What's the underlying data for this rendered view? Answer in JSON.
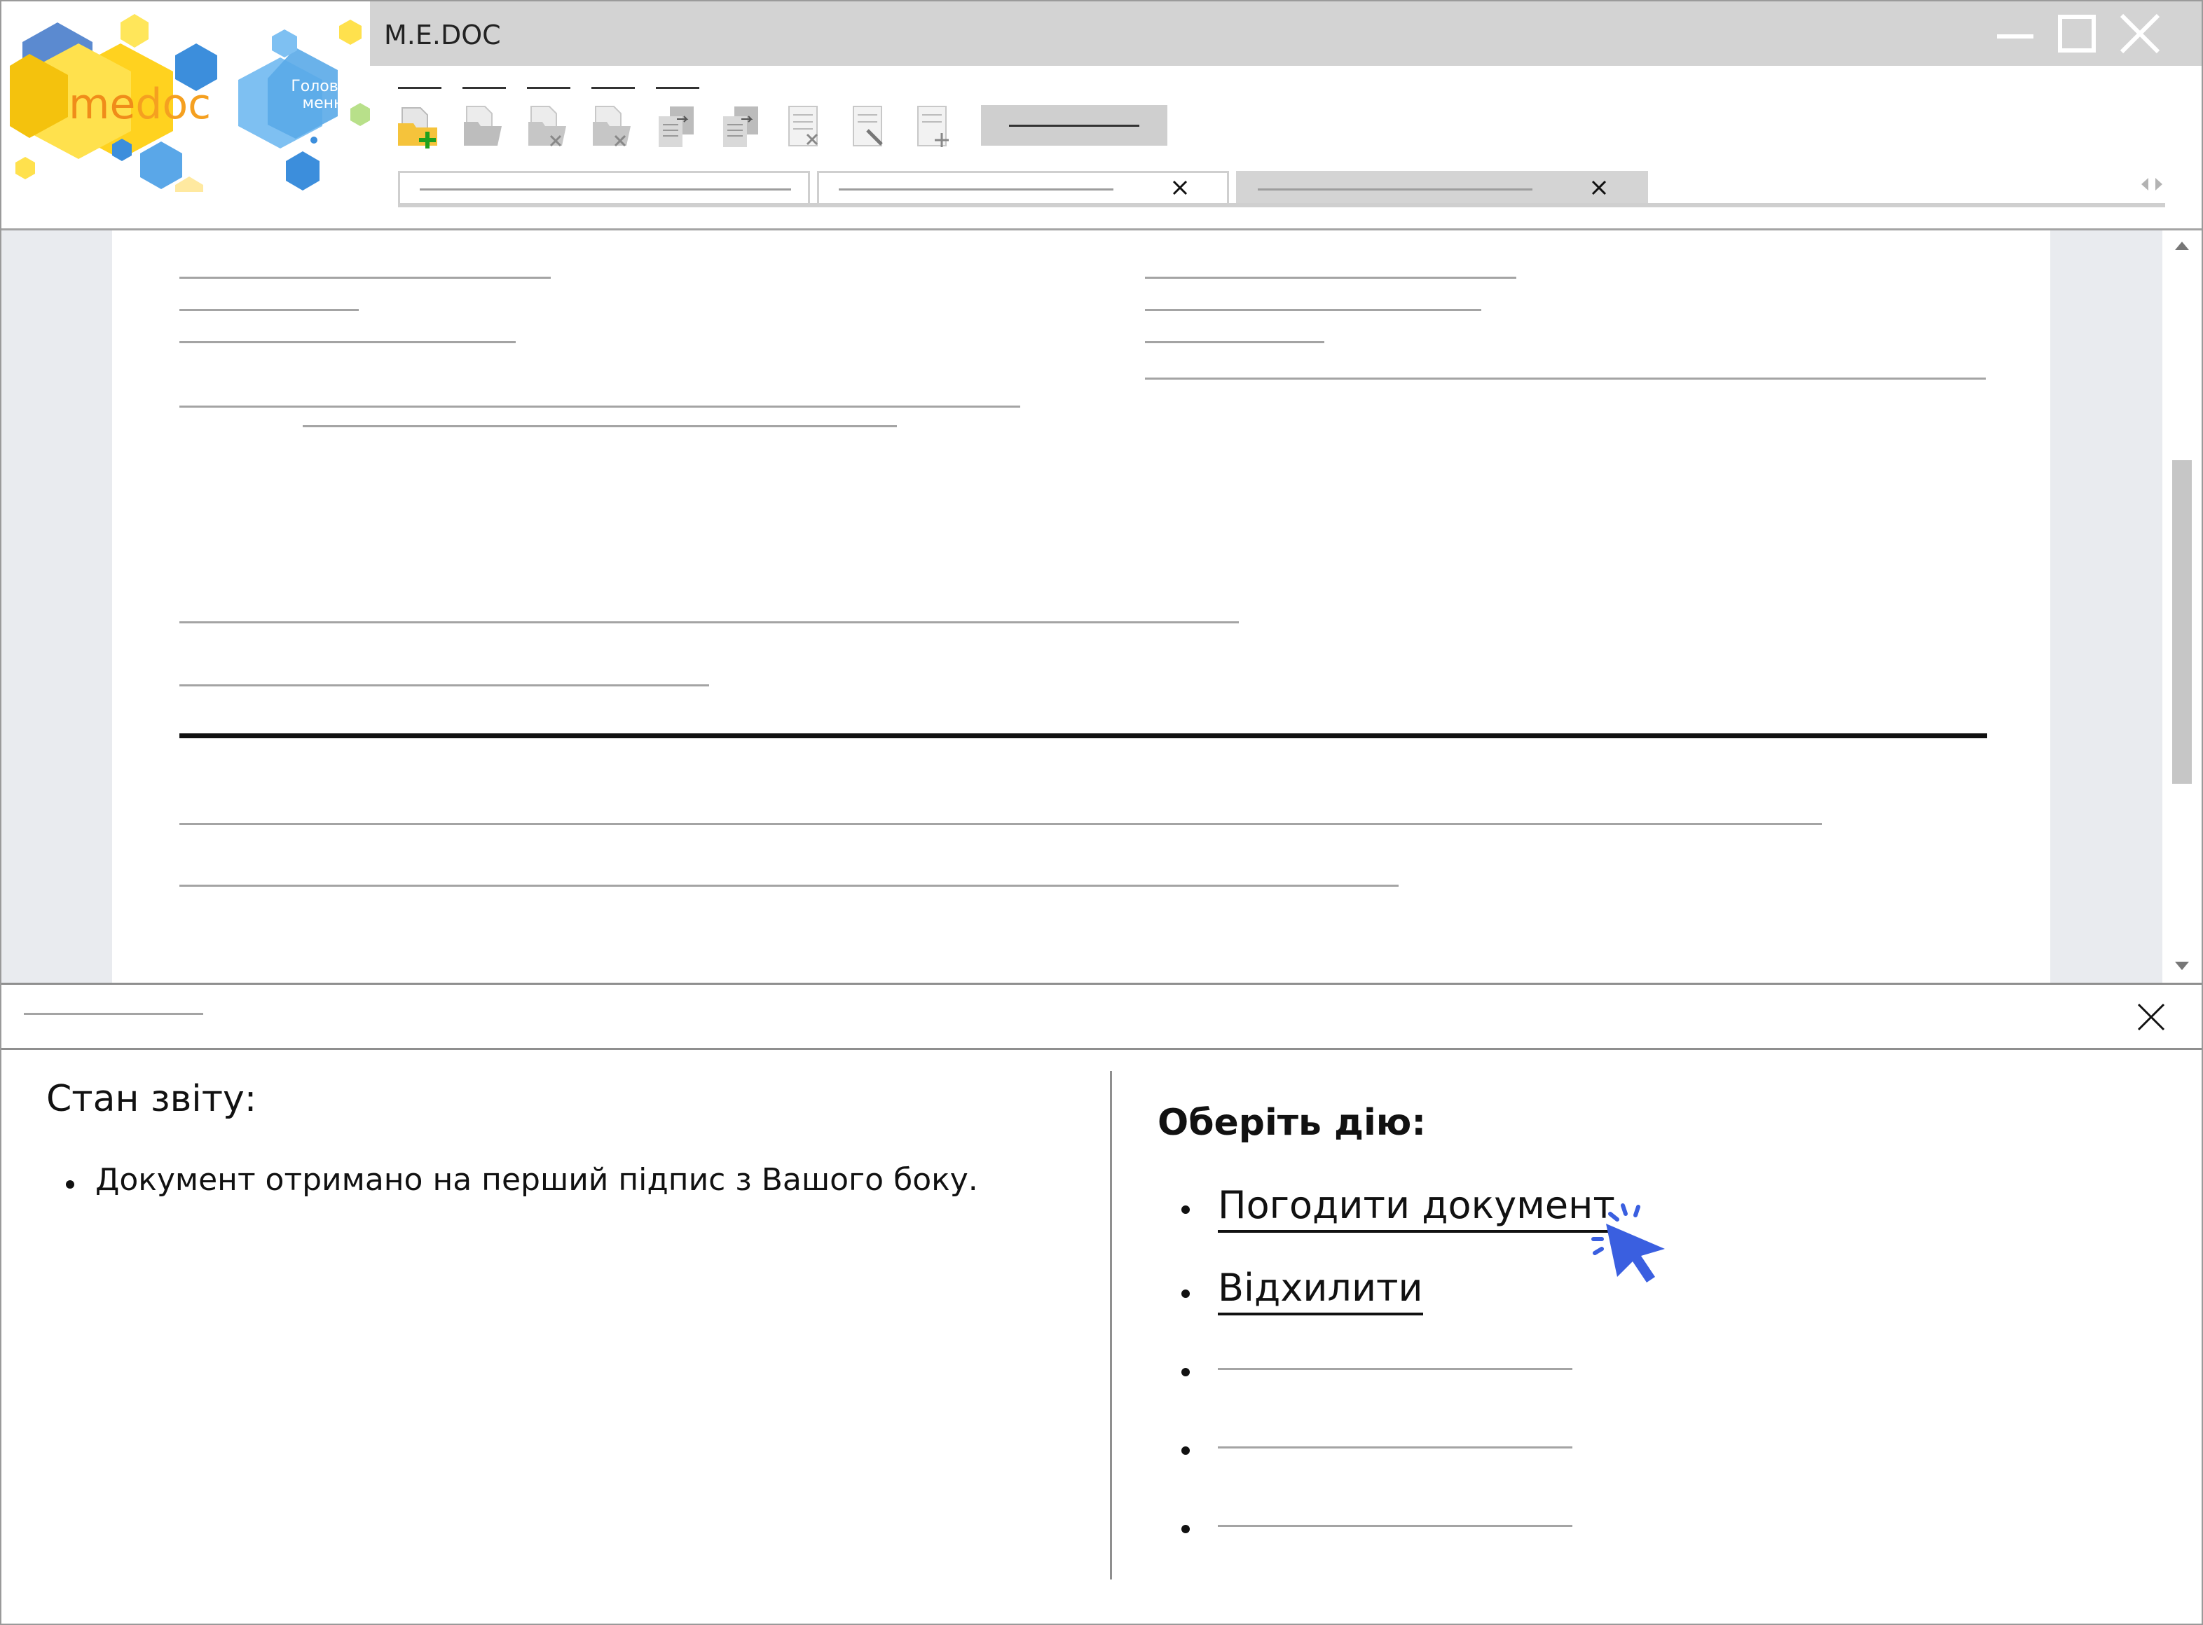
{
  "window": {
    "title": "M.E.DOC",
    "logo_text_left": "me",
    "logo_text_right": "doc",
    "main_menu_label": "Головне меню"
  },
  "colors": {
    "logo_yellow": "#FFD21F",
    "logo_blue": "#3C8EDC",
    "cursor_blue": "#3A5FE0",
    "title_bar": "#D3D3D3"
  },
  "toolbar": {
    "icons": [
      "new-document-icon",
      "open-folder-icon",
      "delete-folder-icon",
      "delete-file-icon",
      "copy-document-icon",
      "move-document-icon",
      "remove-page-icon",
      "edit-page-icon",
      "add-page-icon"
    ]
  },
  "report_state": {
    "title": "Стан звіту:",
    "items": [
      "Документ отримано на перший підпис з Вашого боку."
    ]
  },
  "actions": {
    "title": "Оберіть дію:",
    "items": [
      {
        "label": "Погодити документ"
      },
      {
        "label": "Відхилити"
      }
    ]
  }
}
